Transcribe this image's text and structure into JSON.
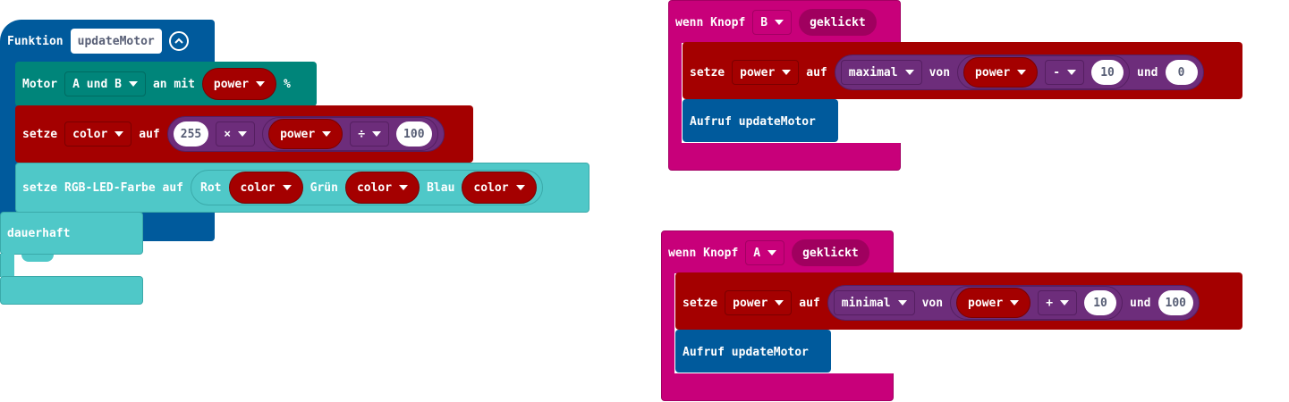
{
  "colors": {
    "function": "#005A9C",
    "motor": "#00857A",
    "variables": "#A40000",
    "math": "#6D2D7B",
    "led": "#4FC8C8",
    "events": "#C8007A",
    "white": "#FFFFFF"
  },
  "func": {
    "keyword": "Funktion",
    "name": "updateMotor",
    "collapse_icon": "chevron-up-icon",
    "motor": {
      "label": "Motor",
      "which": "A und B",
      "on": "an mit",
      "var": "power",
      "unit": "%"
    },
    "set_color": {
      "label": "setze",
      "var": "color",
      "to": "auf",
      "left": "255",
      "op1": "×",
      "var2": "power",
      "op2": "÷",
      "right": "100"
    },
    "rgb": {
      "label": "setze RGB-LED-Farbe auf",
      "r_label": "Rot",
      "r_var": "color",
      "g_label": "Grün",
      "g_var": "color",
      "b_label": "Blau",
      "b_var": "color"
    }
  },
  "forever": {
    "label": "dauerhaft"
  },
  "button_b": {
    "when": "wenn Knopf",
    "button": "B",
    "event": "geklickt",
    "set": {
      "label": "setze",
      "var": "power",
      "to": "auf",
      "fn": "maximal",
      "of": "von",
      "arg1": "power",
      "op": "-",
      "num": "10",
      "and": "und",
      "arg2": "0"
    },
    "call": "Aufruf updateMotor"
  },
  "button_a": {
    "when": "wenn Knopf",
    "button": "A",
    "event": "geklickt",
    "set": {
      "label": "setze",
      "var": "power",
      "to": "auf",
      "fn": "minimal",
      "of": "von",
      "arg1": "power",
      "op": "+",
      "num": "10",
      "and": "und",
      "arg2": "100"
    },
    "call": "Aufruf updateMotor"
  }
}
